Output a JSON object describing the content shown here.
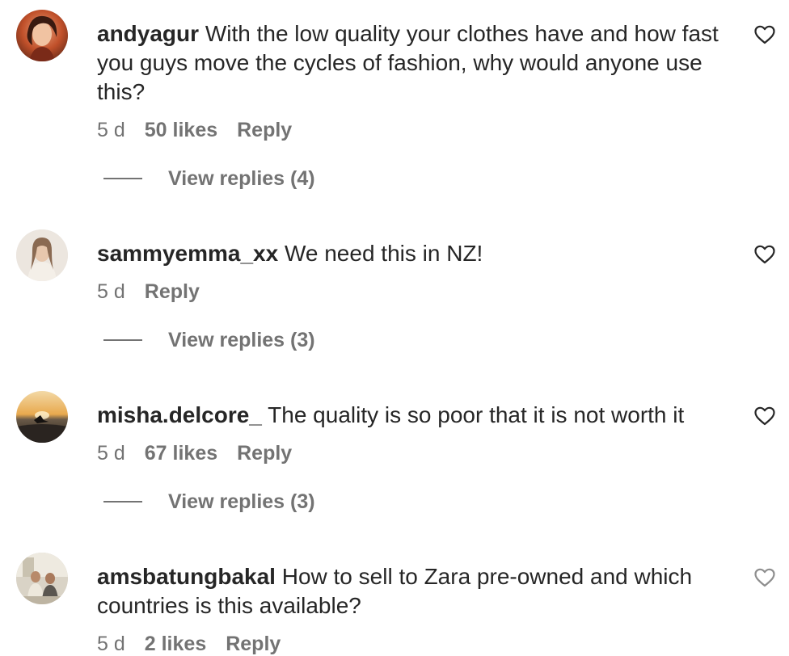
{
  "comments": [
    {
      "username": "andyagur",
      "text": "With the low quality your clothes have and how fast you guys move the cycles of fashion, why would anyone use this?",
      "time": "5 d",
      "likes": "50 likes",
      "reply": "Reply",
      "view_replies": "View replies (4)",
      "avatar_icon": "profile-photo-andyagur"
    },
    {
      "username": "sammyemma_xx",
      "text": "We need this in NZ!",
      "time": "5 d",
      "likes": "",
      "reply": "Reply",
      "view_replies": "View replies (3)",
      "avatar_icon": "profile-photo-sammyemma_xx"
    },
    {
      "username": "misha.delcore_",
      "text": "The quality is so poor that it is not worth it",
      "time": "5 d",
      "likes": "67 likes",
      "reply": "Reply",
      "view_replies": "View replies (3)",
      "avatar_icon": "profile-photo-misha.delcore_"
    },
    {
      "username": "amsbatungbakal",
      "text": "How to sell to Zara pre-owned and which countries is this available?",
      "time": "5 d",
      "likes": "2 likes",
      "reply": "Reply",
      "view_replies": "",
      "avatar_icon": "profile-photo-amsbatungbakal"
    }
  ],
  "icons": {
    "like": "heart-outline-icon"
  },
  "colors": {
    "text": "#262626",
    "secondary": "#737373",
    "background": "#ffffff"
  }
}
